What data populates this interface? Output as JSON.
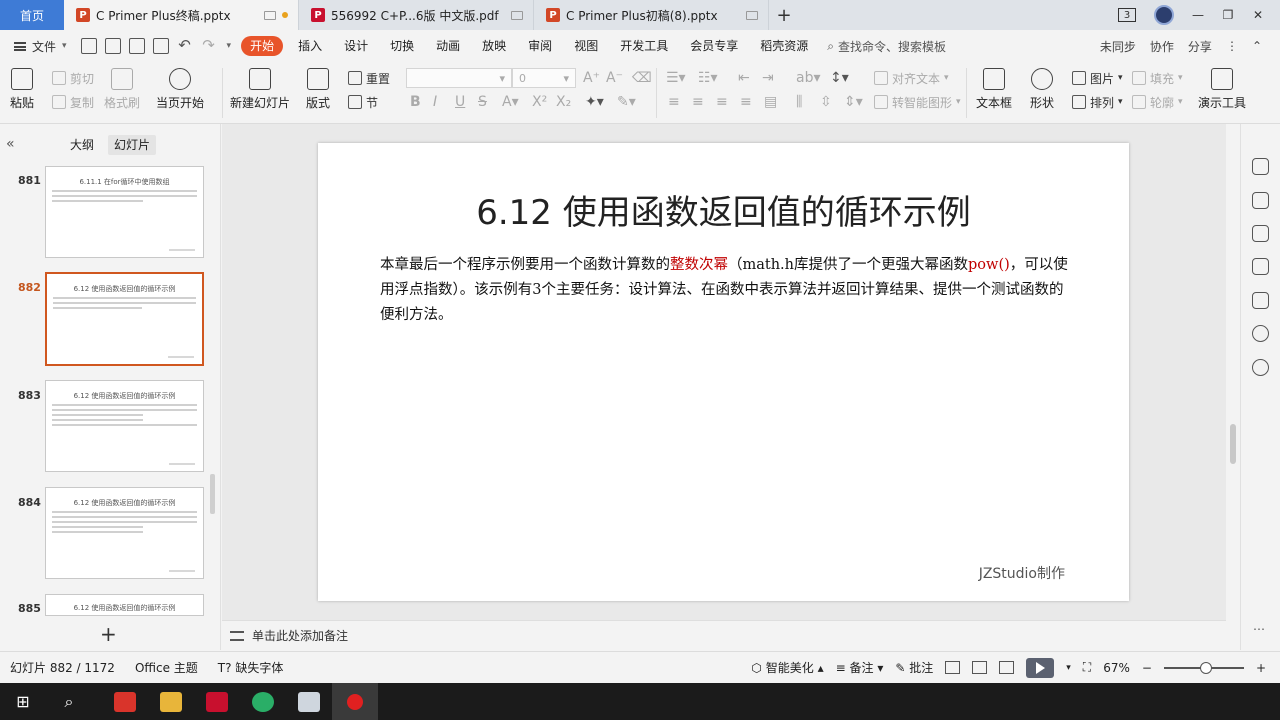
{
  "tabs": {
    "home": "首页",
    "items": [
      {
        "title": "C Primer  Plus终稿.pptx",
        "icon": "P"
      },
      {
        "title": "556992 C+P...6版 中文版.pdf",
        "icon": "P"
      },
      {
        "title": "C Primer  Plus初稿(8).pptx",
        "icon": "P"
      }
    ],
    "add": "+",
    "window_badge": "3"
  },
  "menu": {
    "file": "文件",
    "items": [
      "开始",
      "插入",
      "设计",
      "切换",
      "动画",
      "放映",
      "审阅",
      "视图",
      "开发工具",
      "会员专享",
      "稻壳资源"
    ],
    "active": "开始",
    "search": "查找命令、搜索模板",
    "right": [
      "未同步",
      "协作",
      "分享"
    ]
  },
  "ribbon": {
    "paste": "粘贴",
    "cut": "剪切",
    "copy": "复制",
    "format_painter": "格式刷",
    "play_from_current": "当页开始",
    "new_slide": "新建幻灯片",
    "layout": "版式",
    "reset": "重置",
    "section": "节",
    "font_size": "0",
    "align_text": "对齐文本",
    "smart_convert": "转智能图形",
    "textbox": "文本框",
    "shape": "形状",
    "picture": "图片",
    "arrange": "排列",
    "fill": "填充",
    "outline": "轮廓",
    "present_tools": "演示工具"
  },
  "leftpanel": {
    "tab_outline": "大纲",
    "tab_slides": "幻灯片",
    "slides": [
      {
        "num": "881",
        "title": "6.11.1 在for循环中使用数组"
      },
      {
        "num": "882",
        "title": "6.12 使用函数返回值的循环示例"
      },
      {
        "num": "883",
        "title": "6.12 使用函数返回值的循环示例"
      },
      {
        "num": "884",
        "title": "6.12 使用函数返回值的循环示例"
      },
      {
        "num": "885",
        "title": "6.12 使用函数返回值的循环示例"
      }
    ],
    "add": "+"
  },
  "slide": {
    "title": "6.12 使用函数返回值的循环示例",
    "body_p1": "本章最后一个程序示例要用一个函数计算数的",
    "body_red1": "整数次幂",
    "body_p2": "（math.h库提供了一个更强大幂函数",
    "body_red2": "pow()",
    "body_p3": "，可以使用浮点指数）。该示例有3个主要任务：设计算法、在函数中表示算法并返回计算结果、提供一个测试函数的便利方法。",
    "footer": "JZStudio制作"
  },
  "notes": {
    "placeholder": "单击此处添加备注"
  },
  "status": {
    "slide_counter": "幻灯片 882 / 1172",
    "theme": "Office 主题",
    "missing_font": "缺失字体",
    "smart_beautify": "智能美化",
    "notes": "备注",
    "comments": "批注",
    "zoom": "67%"
  },
  "colors": {
    "accent": "#e8542a",
    "home_tab": "#3e7bd6",
    "slide_red": "#c00000"
  }
}
